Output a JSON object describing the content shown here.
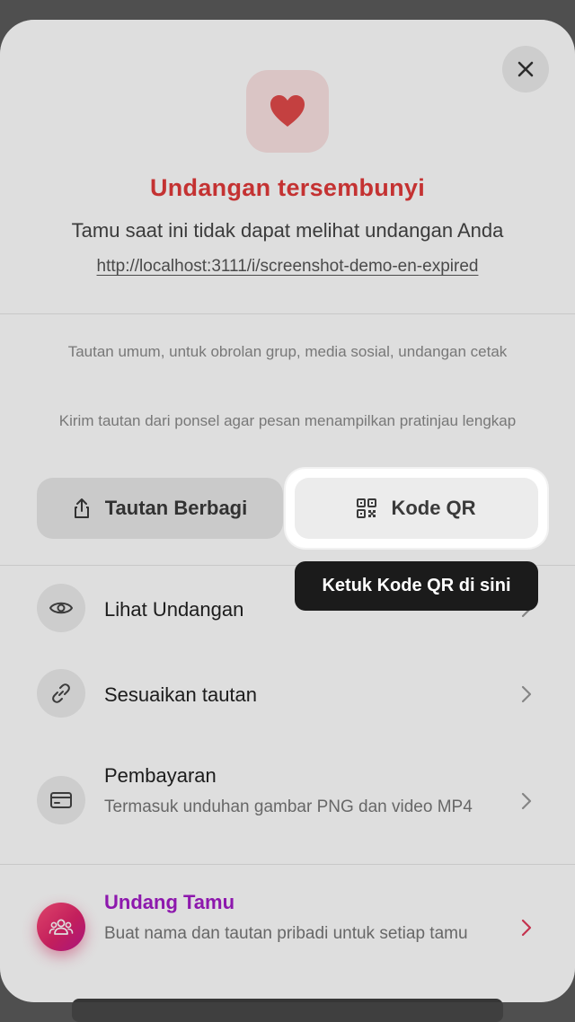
{
  "header": {
    "close_icon": "close-icon",
    "heart_icon": "heart-icon",
    "title": "Undangan tersembunyi",
    "subtitle": "Tamu saat ini tidak dapat melihat undangan Anda",
    "url": "http://localhost:3111/i/screenshot-demo-en-expired"
  },
  "share": {
    "note1": "Tautan umum, untuk obrolan grup, media sosial, undangan cetak",
    "note2": "Kirim tautan dari ponsel agar pesan menampilkan pratinjau lengkap",
    "share_label": "Tautan Berbagi",
    "qr_label": "Kode QR",
    "tooltip": "Ketuk Kode QR di sini"
  },
  "menu": [
    {
      "title": "Lihat Undangan",
      "icon": "eye-icon"
    },
    {
      "title": "Sesuaikan tautan",
      "icon": "link-icon"
    },
    {
      "title": "Pembayaran",
      "desc": "Termasuk unduhan gambar PNG dan video MP4",
      "icon": "card-icon"
    },
    {
      "title": "Undang Tamu",
      "desc": "Buat nama dan tautan pribadi untuk setiap tamu",
      "icon": "guests-icon"
    }
  ],
  "colors": {
    "accent_red": "#e23a3a",
    "invite_purple": "#a21cc7",
    "tooltip_bg": "#1b1b1b"
  }
}
